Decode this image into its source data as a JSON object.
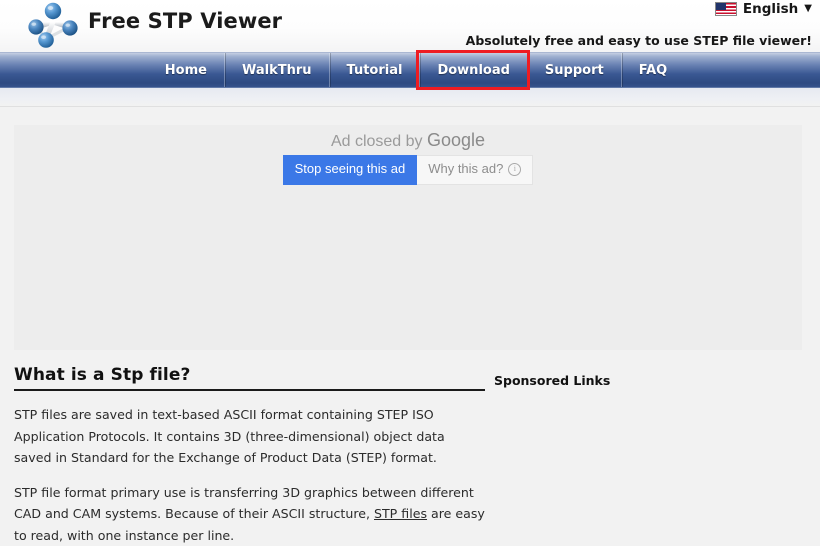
{
  "header": {
    "logo_icon": "molecule-icon",
    "brand_title": "Free STP Viewer",
    "language": {
      "flag_icon": "us-flag-icon",
      "label": "English",
      "caret_icon": "chevron-down-icon"
    },
    "tagline": "Absolutely free and easy to use STEP file viewer!"
  },
  "nav": {
    "items": [
      {
        "label": "Home",
        "name": "nav-item-home",
        "highlighted": false
      },
      {
        "label": "WalkThru",
        "name": "nav-item-walkthru",
        "highlighted": false
      },
      {
        "label": "Tutorial",
        "name": "nav-item-tutorial",
        "highlighted": false
      },
      {
        "label": "Download",
        "name": "nav-item-download",
        "highlighted": true
      },
      {
        "label": "Support",
        "name": "nav-item-support",
        "highlighted": false
      },
      {
        "label": "FAQ",
        "name": "nav-item-faq",
        "highlighted": false
      }
    ],
    "highlight_color": "#ee1c22"
  },
  "ad": {
    "closed_prefix": "Ad closed by ",
    "closed_brand": "Google",
    "stop_button": "Stop seeing this ad",
    "why_button": "Why this ad?",
    "why_icon": "info-icon",
    "stop_button_color": "#3b78e7"
  },
  "main": {
    "section_title": "What is a Stp file?",
    "paragraph1_part1": "STP files are saved in text-based ASCII format containing STEP ISO Application Protocols. It contains 3D (three-dimensional) object data saved in Standard for the Exchange of Product Data (STEP) format.",
    "paragraph2_part1": "STP file format primary use is transferring 3D graphics between different CAD and CAM systems. Because of their ASCII structure, ",
    "paragraph2_link": "STP files",
    "paragraph2_part2": " are easy to read, with one instance per line."
  },
  "sidebar": {
    "sponsored_title": "Sponsored Links"
  }
}
